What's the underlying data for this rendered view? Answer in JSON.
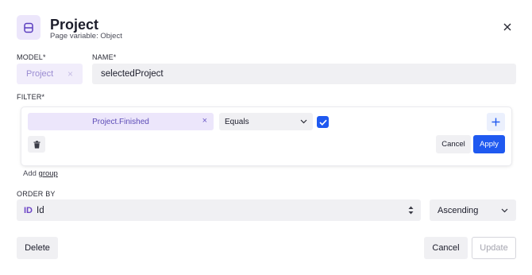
{
  "header": {
    "title": "Project",
    "subtitle": "Page variable: Object",
    "icon": "database-icon",
    "close_icon": "close-icon"
  },
  "model": {
    "label": "MODEL*",
    "value": "Project",
    "clear_glyph": "×"
  },
  "name": {
    "label": "NAME*",
    "value": "selectedProject"
  },
  "filter": {
    "label": "FILTER*",
    "field": "Project.Finished",
    "field_clear_glyph": "×",
    "operator": "Equals",
    "checked": true,
    "cancel_label": "Cancel",
    "apply_label": "Apply",
    "add_prefix": "Add",
    "add_link": "group"
  },
  "order_by": {
    "label": "ORDER BY",
    "badge": "ID",
    "field": "Id",
    "direction": "Ascending"
  },
  "footer": {
    "delete_label": "Delete",
    "cancel_label": "Cancel",
    "update_label": "Update"
  },
  "colors": {
    "accent": "#1f59f0",
    "model_purple": "#9a8cd2",
    "field_purple": "#5c4bb6",
    "id_badge": "#6d46c7"
  }
}
